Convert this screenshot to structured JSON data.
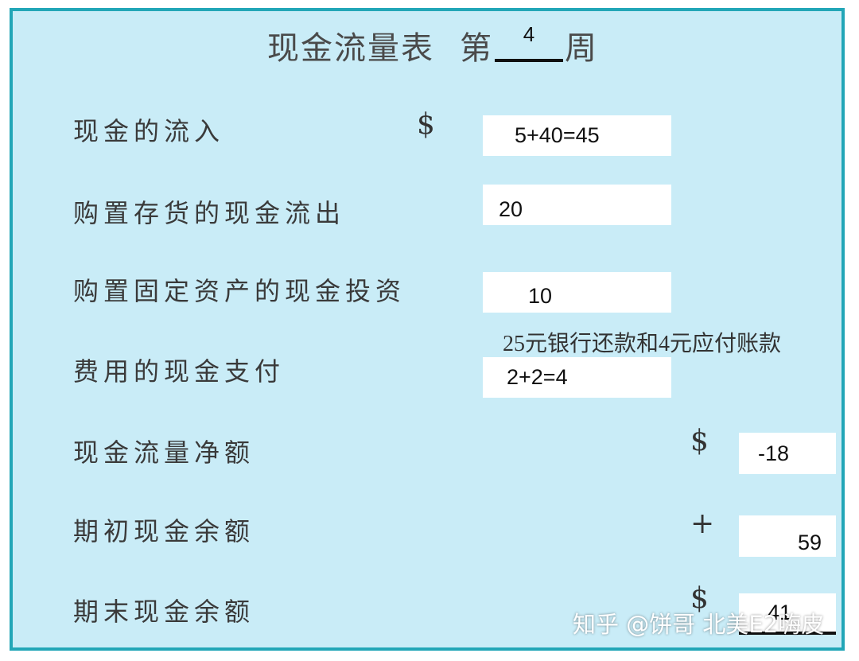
{
  "header": {
    "title": "现金流量表",
    "week_prefix": "第",
    "week_number": "4",
    "week_suffix": "周"
  },
  "rows": [
    {
      "label": "现金的流入",
      "symbol": "$",
      "value": "5+40=45"
    },
    {
      "label": "购置存货的现金流出",
      "symbol": "",
      "value": "20"
    },
    {
      "label": "购置固定资产的现金投资",
      "symbol": "",
      "value": "10"
    },
    {
      "label": "费用的现金支付",
      "symbol": "",
      "value": "2+2=4",
      "note": "25元银行还款和4元应付账款"
    },
    {
      "label": "现金流量净额",
      "symbol": "$",
      "value": "-18"
    },
    {
      "label": "期初现金余额",
      "symbol": "+",
      "value": "59"
    },
    {
      "label": "期末现金余额",
      "symbol": "$",
      "value": "41"
    }
  ],
  "watermark": "知乎 @饼哥 北美E2嗨皮",
  "colors": {
    "background": "#c9ecf7",
    "border": "#22a6b7",
    "box": "#ffffff"
  }
}
